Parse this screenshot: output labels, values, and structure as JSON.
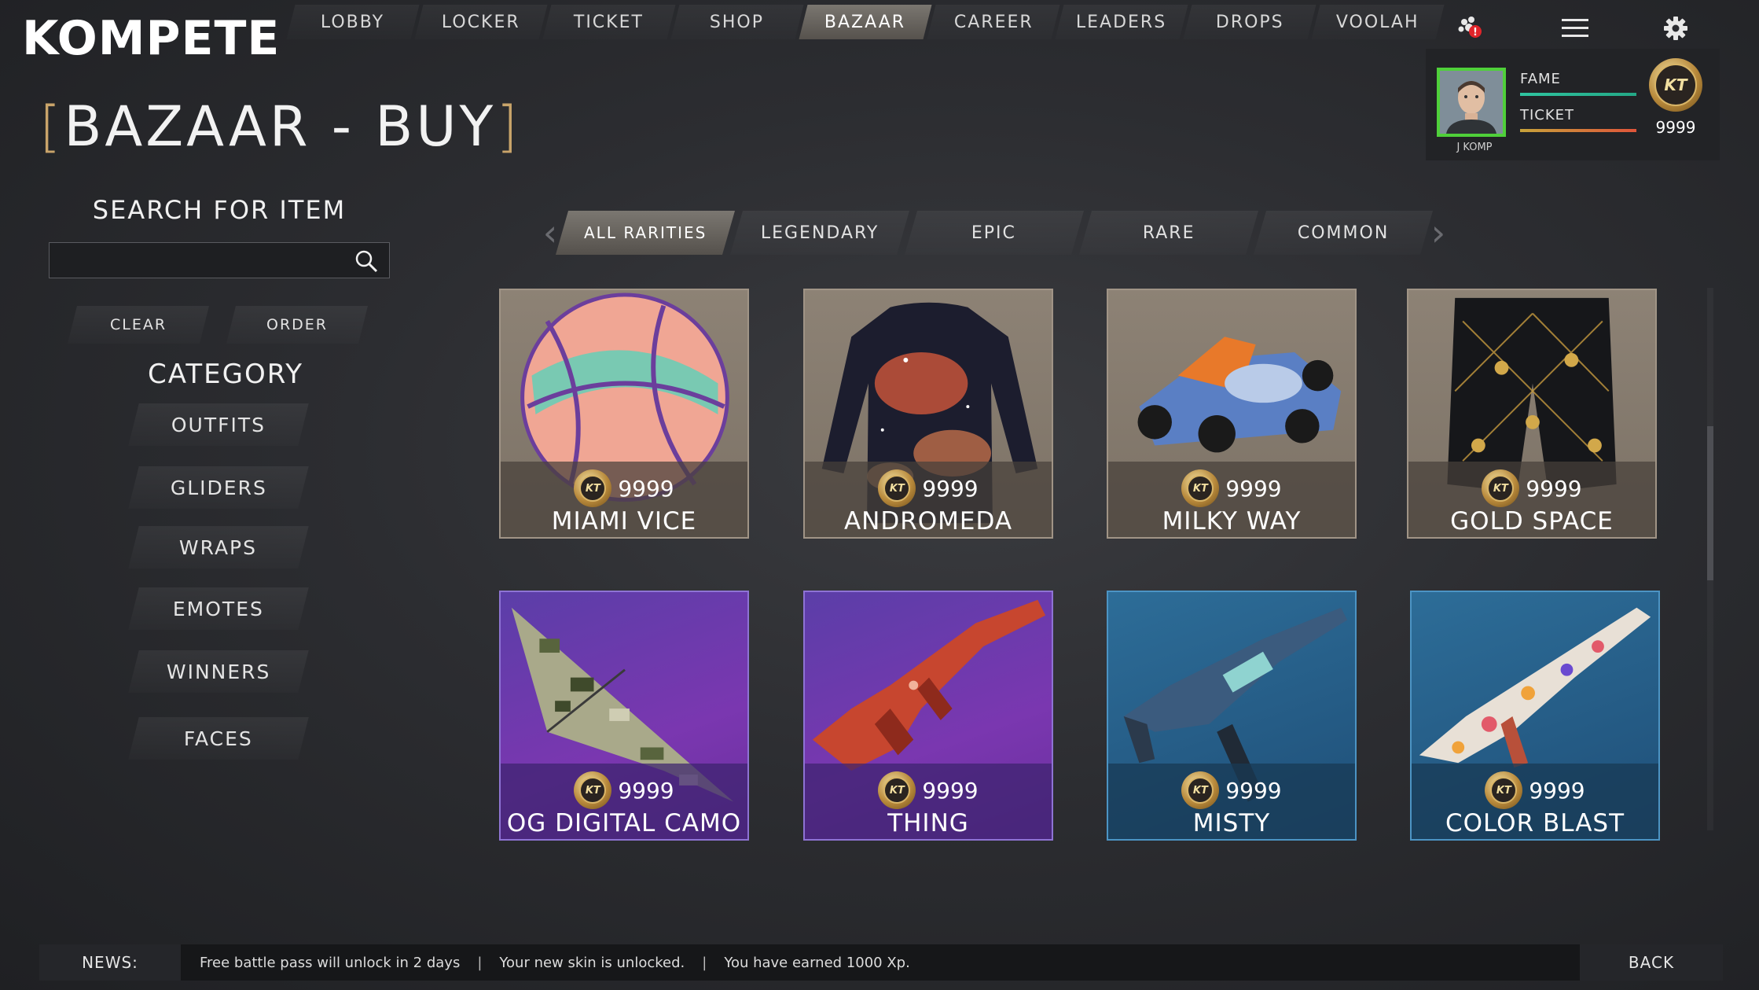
{
  "app": {
    "logo": "KOMPETE"
  },
  "topnav": {
    "tabs": [
      {
        "label": "LOBBY"
      },
      {
        "label": "LOCKER"
      },
      {
        "label": "TICKET"
      },
      {
        "label": "SHOP"
      },
      {
        "label": "BAZAAR",
        "active": true
      },
      {
        "label": "CAREER"
      },
      {
        "label": "LEADERS"
      },
      {
        "label": "DROPS"
      },
      {
        "label": "VOOLAH"
      }
    ],
    "icons": [
      "party-icon",
      "menu-icon",
      "gear-icon"
    ],
    "notification_badge": "!"
  },
  "profile": {
    "username": "J KOMP",
    "fame_label": "FAME",
    "ticket_label": "TICKET",
    "currency_symbol": "KT",
    "currency_amount": "9999",
    "fame_progress": 1.0,
    "ticket_progress": 1.0
  },
  "page": {
    "title_open": "[",
    "title": "BAZAAR - BUY",
    "title_close": "]"
  },
  "search": {
    "heading": "SEARCH FOR ITEM",
    "value": "",
    "placeholder": ""
  },
  "filters": {
    "clear_label": "CLEAR",
    "order_label": "ORDER"
  },
  "category": {
    "heading": "CATEGORY",
    "items": [
      {
        "label": "OUTFITS"
      },
      {
        "label": "GLIDERS"
      },
      {
        "label": "WRAPS"
      },
      {
        "label": "EMOTES"
      },
      {
        "label": "WINNERS"
      },
      {
        "label": "FACES"
      }
    ]
  },
  "rarity": {
    "left_arrow": "‹",
    "right_arrow": "›",
    "tabs": [
      {
        "label": "ALL RARITIES",
        "active": true
      },
      {
        "label": "LEGENDARY"
      },
      {
        "label": "EPIC"
      },
      {
        "label": "RARE"
      },
      {
        "label": "COMMON"
      }
    ]
  },
  "items": [
    {
      "name": "MIAMI VICE",
      "price": "9999",
      "coin": "KT",
      "theme": "tan",
      "art": "basketball"
    },
    {
      "name": "ANDROMEDA",
      "price": "9999",
      "coin": "KT",
      "theme": "tan",
      "art": "shirt"
    },
    {
      "name": "MILKY WAY",
      "price": "9999",
      "coin": "KT",
      "theme": "tan",
      "art": "kart"
    },
    {
      "name": "GOLD SPACE",
      "price": "9999",
      "coin": "KT",
      "theme": "tan",
      "art": "shorts"
    },
    {
      "name": "OG DIGITAL CAMO",
      "price": "9999",
      "coin": "KT",
      "theme": "purple",
      "art": "glider"
    },
    {
      "name": "THING",
      "price": "9999",
      "coin": "KT",
      "theme": "purple",
      "art": "rifle"
    },
    {
      "name": "MISTY",
      "price": "9999",
      "coin": "KT",
      "theme": "blue",
      "art": "smg"
    },
    {
      "name": "COLOR BLAST",
      "price": "9999",
      "coin": "KT",
      "theme": "blue",
      "art": "blaster"
    }
  ],
  "news": {
    "label": "NEWS:",
    "messages": [
      "Free battle pass will unlock in 2 days",
      "Your new skin is unlocked.",
      "You have earned 1000 Xp."
    ],
    "separator": "|"
  },
  "back_label": "BACK",
  "colors": {
    "avatar_border": "#4fd03a",
    "fame_bar": "#2fc4a0",
    "ticket_bar": "#e0553a",
    "active_tab": "#6c6863",
    "gold": "#d9b567"
  }
}
